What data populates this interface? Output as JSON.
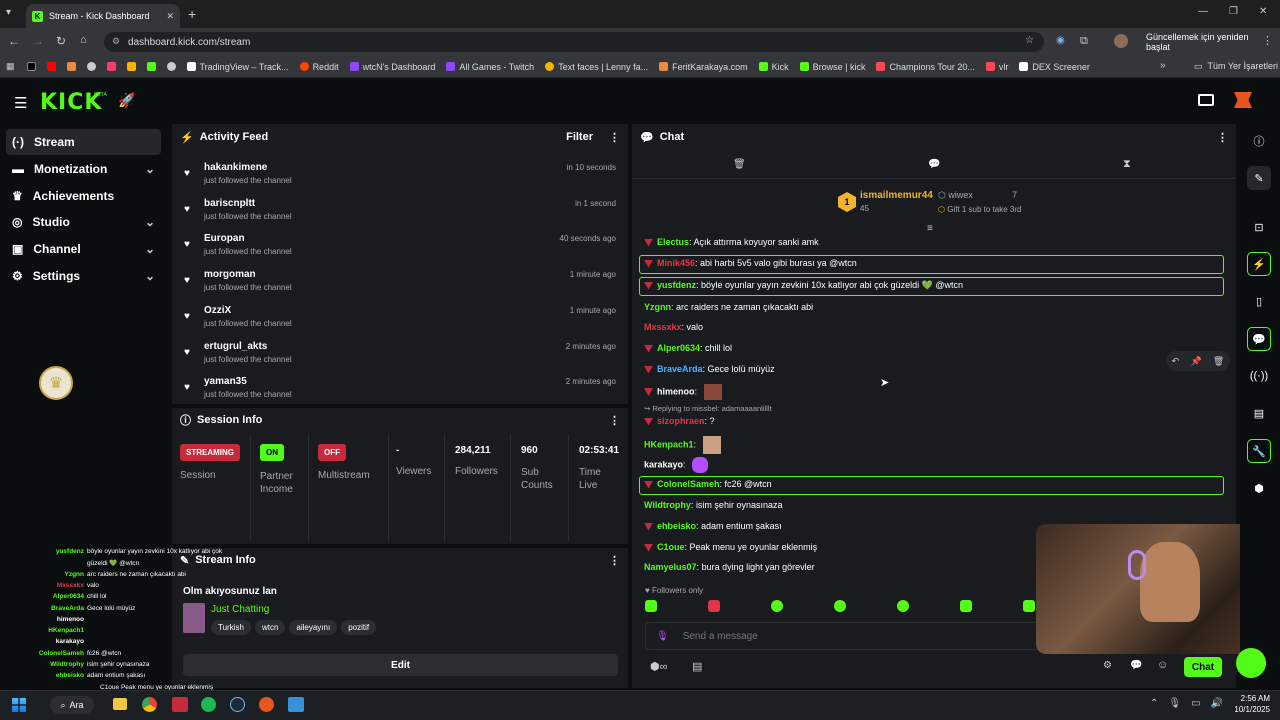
{
  "browser": {
    "tab_title": "Stream - Kick Dashboard",
    "url": "dashboard.kick.com/stream",
    "update_button": "Güncellemek için yeniden başlat",
    "bookmarks": [
      "TradingView – Track...",
      "Reddit",
      "wtcN's Dashboard",
      "All Games - Twitch",
      "Text faces | Lenny fa...",
      "FeritKarakaya.com",
      "Kick",
      "Browse | kick",
      "Champions Tour 20...",
      "vlr",
      "DEX Screener"
    ],
    "all_bookmarks": "Tüm Yer İşaretleri"
  },
  "brand": {
    "logo": "KICK",
    "beta": "BETA"
  },
  "nav": [
    {
      "label": "Stream",
      "icon": "broadcast-icon"
    },
    {
      "label": "Monetization",
      "icon": "money-icon",
      "chevron": true
    },
    {
      "label": "Achievements",
      "icon": "trophy-icon"
    },
    {
      "label": "Studio",
      "icon": "studio-icon",
      "chevron": true
    },
    {
      "label": "Channel",
      "icon": "channel-icon",
      "chevron": true
    },
    {
      "label": "Settings",
      "icon": "gear-icon",
      "chevron": true
    }
  ],
  "activity": {
    "title": "Activity Feed",
    "filter": "Filter",
    "items": [
      {
        "name": "hakankimene",
        "sub": "just followed the channel",
        "time": "in 10 seconds"
      },
      {
        "name": "bariscnpltt",
        "sub": "just followed the channel",
        "time": "in 1 second"
      },
      {
        "name": "Europan",
        "sub": "just followed the channel",
        "time": "40 seconds ago"
      },
      {
        "name": "morgoman",
        "sub": "just followed the channel",
        "time": "1 minute ago"
      },
      {
        "name": "OzziX",
        "sub": "just followed the channel",
        "time": "1 minute ago"
      },
      {
        "name": "ertugrul_akts",
        "sub": "just followed the channel",
        "time": "2 minutes ago"
      },
      {
        "name": "yaman35",
        "sub": "just followed the channel",
        "time": "2 minutes ago"
      }
    ]
  },
  "session": {
    "title": "Session Info",
    "streaming": "STREAMING",
    "session_label": "Session",
    "on": "ON",
    "partner_label": "Partner Income",
    "off": "OFF",
    "multistream_label": "Multistream",
    "viewers_value": "-",
    "viewers_label": "Viewers",
    "followers_value": "284,211",
    "followers_label": "Followers",
    "subs_value": "960",
    "subs_label": "Sub Counts",
    "time_value": "02:53:41",
    "time_label": "Time Live"
  },
  "stream_info": {
    "title": "Stream Info",
    "stream_title": "Olm akıyosunuz lan",
    "category": "Just Chatting",
    "tags": [
      "Turkish",
      "wtcn",
      "aileyayını",
      "pozitif"
    ],
    "edit": "Edit"
  },
  "chat": {
    "title": "Chat",
    "leader": {
      "rank": "1",
      "name": "ismailmemur44",
      "count": "45",
      "other": "wiwex",
      "other_count": "7",
      "gift_text": "Gift 1 sub to take 3rd"
    },
    "messages": [
      {
        "user": "Electus",
        "text": "Açık attırma koyuyor sanki amk",
        "color": "#53fc18",
        "badge": true
      },
      {
        "user": "Minik456",
        "text": "abi harbi 5v5 valo gibi burası ya @wtcn",
        "color": "#e0364b",
        "badge": true,
        "hl": true
      },
      {
        "user": "yusfdenz",
        "text": "böyle oyunlar yayın zevkini 10x katlıyor abi çok güzeldi 💚 @wtcn",
        "color": "#53fc18",
        "badge": true,
        "hl": true
      },
      {
        "user": "Yzgnn",
        "text": "arc raiders ne zaman çıkacaktı abi",
        "color": "#53fc18"
      },
      {
        "user": "Mxssxkx",
        "text": "valo",
        "color": "#e0364b"
      },
      {
        "user": "Alper0634",
        "text": "chill lol",
        "color": "#53fc18",
        "badge": true
      },
      {
        "user": "BraveArda",
        "text": "Gece lolü müyüz",
        "color": "#4fb0ff",
        "badge": true
      },
      {
        "user": "himenoo",
        "text": "",
        "color": "#fff",
        "badge": true
      },
      {
        "reply": "Replying to missbel: adamaaaanlilllt"
      },
      {
        "user": "sizophraen",
        "text": "?",
        "color": "#e0364b",
        "badge": true
      },
      {
        "user": "HKenpach1",
        "text": "",
        "color": "#53fc18"
      },
      {
        "user": "karakayo",
        "text": "",
        "color": "#fff"
      },
      {
        "user": "ColonelSameh",
        "text": "fc26 @wtcn",
        "color": "#53fc18",
        "badge": true,
        "hl": true
      },
      {
        "user": "Wildtrophy",
        "text": "isim şehir oynasınaza",
        "color": "#53fc18"
      },
      {
        "user": "ehbeisko",
        "text": "adam entium şakası",
        "color": "#53fc18",
        "badge": true
      },
      {
        "user": "C1oue",
        "text": "Peak menu ye oyunlar eklenmiş",
        "color": "#53fc18",
        "badge": true
      },
      {
        "user": "Namyelus07",
        "text": "bura dying light yan görevler",
        "color": "#53fc18"
      }
    ],
    "followers_only": "Followers only",
    "placeholder": "Send a message",
    "chat_button": "Chat"
  },
  "overlay": [
    {
      "u": "yusfdenz",
      "t": "böyle oyunlar yayın zevkini 10x katlıyor abi çok"
    },
    {
      "u": "",
      "t": "güzeldi 💚 @wtcn"
    },
    {
      "u": "Yzgnn",
      "t": "arc raiders ne zaman çıkacaktı abi"
    },
    {
      "u": "Mxssxkx",
      "t": "valo"
    },
    {
      "u": "Alper0634",
      "t": "chill lol"
    },
    {
      "u": "BraveArda",
      "t": "Gece lolü müyüz"
    },
    {
      "u": "himenoo",
      "t": ""
    },
    {
      "u": "HKenpach1",
      "t": ""
    },
    {
      "u": "karakayo",
      "t": ""
    },
    {
      "u": "ColonelSameh",
      "t": "fc26 @wtcn"
    },
    {
      "u": "Wildtrophy",
      "t": "isim şehir oynasınaza"
    },
    {
      "u": "ehbeisko",
      "t": "adam entium şakası"
    }
  ],
  "overlay_bottom": "C1oue  Peak menu ye oyunlar eklenmiş",
  "taskbar": {
    "search": "Ara",
    "time": "2:56 AM",
    "date": "10/1/2025"
  }
}
